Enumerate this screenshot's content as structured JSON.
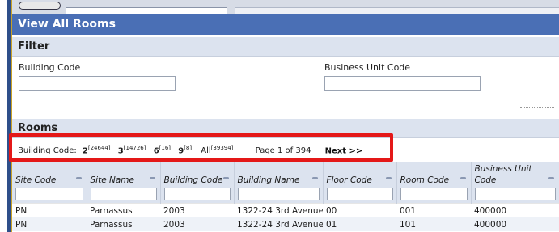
{
  "page": {
    "title": "View All Rooms"
  },
  "filter": {
    "heading": "Filter",
    "building_code_label": "Building Code",
    "building_code_value": "",
    "business_unit_label": "Business Unit Code",
    "business_unit_value": ""
  },
  "rooms": {
    "heading": "Rooms",
    "pager": {
      "label": "Building Code:",
      "groups": [
        {
          "num": "2",
          "count": "[24644]"
        },
        {
          "num": "3",
          "count": "[14726]"
        },
        {
          "num": "6",
          "count": "[16]"
        },
        {
          "num": "9",
          "count": "[8]"
        }
      ],
      "all_label": "All",
      "all_count": "[39394]",
      "page_info": "Page 1 of 394",
      "next_label": "Next >>"
    },
    "columns": [
      "Site Code",
      "Site Name",
      "Building Code",
      "Building Name",
      "Floor Code",
      "Room Code",
      "Business Unit Code"
    ],
    "rows": [
      [
        "PN",
        "Parnassus",
        "2003",
        "1322-24 3rd Avenue",
        "00",
        "001",
        "400000"
      ],
      [
        "PN",
        "Parnassus",
        "2003",
        "1322-24 3rd Avenue",
        "01",
        "101",
        "400000"
      ]
    ]
  }
}
